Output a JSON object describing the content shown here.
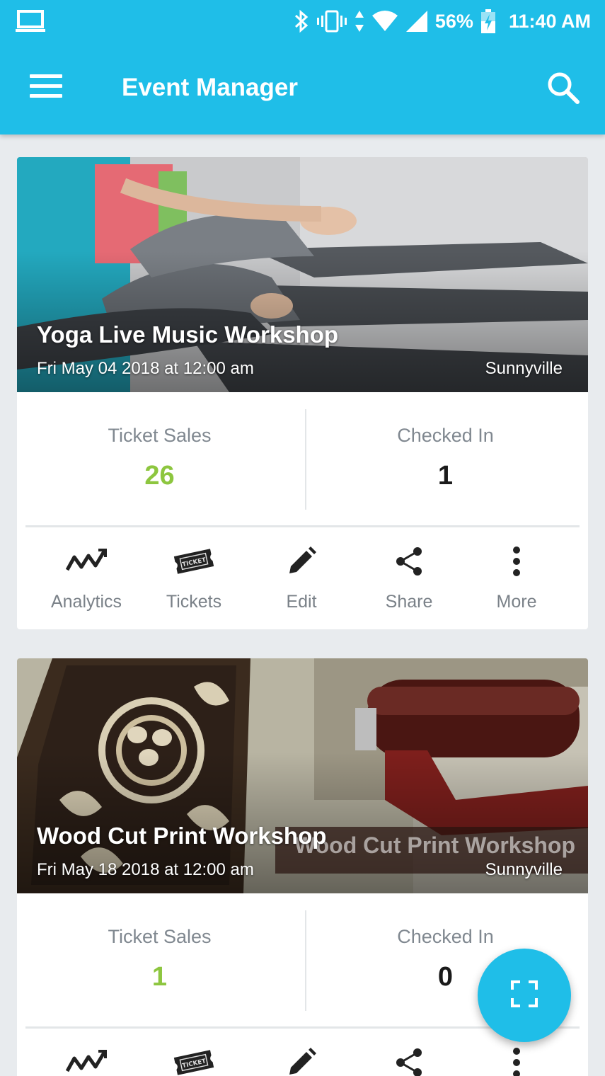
{
  "status_bar": {
    "battery": "56%",
    "time": "11:40 AM"
  },
  "toolbar": {
    "title": "Event Manager"
  },
  "events": [
    {
      "title": "Yoga Live Music Workshop",
      "date": "Fri May 04 2018 at 12:00 am",
      "location": "Sunnyville",
      "ticket_sales_label": "Ticket Sales",
      "ticket_sales": "26",
      "checked_in_label": "Checked In",
      "checked_in": "1"
    },
    {
      "title": "Wood Cut Print Workshop",
      "image_caption": "Wood Cut Print Workshop",
      "date": "Fri May 18 2018 at 12:00 am",
      "location": "Sunnyville",
      "ticket_sales_label": "Ticket Sales",
      "ticket_sales": "1",
      "checked_in_label": "Checked In",
      "checked_in": "0"
    }
  ],
  "actions": {
    "analytics": "Analytics",
    "tickets": "Tickets",
    "edit": "Edit",
    "share": "Share",
    "more": "More"
  },
  "colors": {
    "primary": "#1fbee8",
    "sales_green": "#8dc63f",
    "background": "#e8ebee"
  },
  "icons": {
    "fab": "scan-icon"
  }
}
